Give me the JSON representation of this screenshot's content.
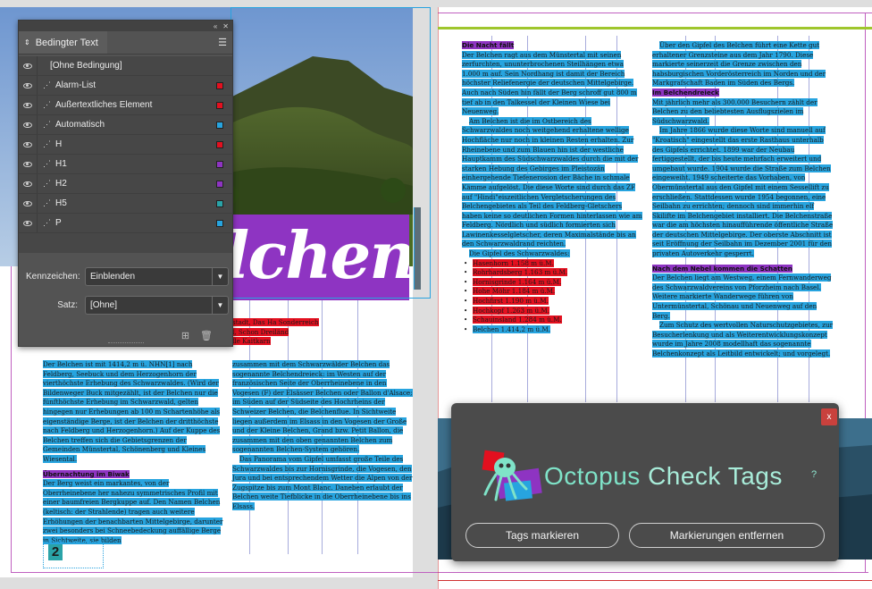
{
  "panel": {
    "title": "Bedingter Text",
    "conditions": [
      {
        "label": "[Ohne Bedingung]",
        "color": "",
        "visible": true,
        "icon": false
      },
      {
        "label": "Alarm-List",
        "color": "#e3101f",
        "visible": true,
        "icon": true
      },
      {
        "label": "Außertextliches Element",
        "color": "#e3101f",
        "visible": true,
        "icon": true
      },
      {
        "label": "Automatisch",
        "color": "#27a4df",
        "visible": true,
        "icon": true
      },
      {
        "label": "H",
        "color": "#e3101f",
        "visible": true,
        "icon": true
      },
      {
        "label": "H1",
        "color": "#8e34c2",
        "visible": true,
        "icon": true
      },
      {
        "label": "H2",
        "color": "#8e34c2",
        "visible": true,
        "icon": true
      },
      {
        "label": "H5",
        "color": "#2aa3a8",
        "visible": true,
        "icon": true
      },
      {
        "label": "P",
        "color": "#27a4df",
        "visible": true,
        "icon": true
      }
    ],
    "indicator_label": "Kennzeichen:",
    "indicator_value": "Einblenden",
    "set_label": "Satz:",
    "set_value": "[Ohne]"
  },
  "dialog": {
    "title_part1": "Octopus",
    "title_part2": "Check Tags",
    "help": "?",
    "close": "x",
    "button_mark": "Tags markieren",
    "button_remove": "Markierungen entfernen"
  },
  "document": {
    "page_number": "2",
    "big_word": "lchen",
    "col1": {
      "p1": "Der Belchen ist mit 1414,2 m ü. NHN[1] nach Feldberg, Seebuck und dem Herzogenhorn der vierthöchste Erhebung des Schwarzwaldes. (Wird der Bildenweger Buck mitgezählt, ist der Belchen nur die fünfthöchste Erhebung im Schwarzwald, gelten hingegen nur Erhebungen ab 100 m Schartenhöhe als eigenständige Berge, ist der Belchen der dritthöchste nach Feldberg und Herzogenhorn.) Auf der Kuppe des Belchen treffen sich die Gebietsgrenzen der Gemeinden Münstertal, Schönenberg und Kleines Wiesental.",
      "h": "Übernachtung im Biwak",
      "p2": "Der Berg weist ein markantes, von der Oberrheinebene her nahezu symmetrisches Profil mit einer baumfreien Bergkuppe auf. Den Namen Belchen (keltisch: der Strahlende) tragen auch weitere Erhöhungen der benachbarten Mittelgebirge, darunter zwei besonders bei Schneebedeckung auffällige Berge in Sichtweite, sie bilden"
    },
    "col2": {
      "red_lines": [
        "stadt, Das Ha Sonderreich",
        "l, Schon Dreiländ",
        "lle Kaitkarn"
      ],
      "p1": "zusammen mit dem Schwarzwälder Belchen das sogenannte Belchendreieck: im Westen auf der französischen Seite der Oberrheinebene in den Vogesen (F) der Elsässer Belchen oder Ballon d'Alsace; im Süden auf der Südseite des Hochrheins der Schweizer Belchen, die Belchenflue. In Sichtweite liegen außerdem im Elsass in den Vogesen der Große und der Kleine Belchen, Grand bzw. Petit Ballon, die zusammen mit den oben genannten Belchen zum sogenannten Belchen-System gehören.",
      "p2": "Das Panorama vom Gipfel umfasst große Teile des Schwarzwaldes bis zur Hornisgrinde, die Vogesen, den Jura und bei entsprechendem Wetter die Alpen von der Zugspitze bis zum Mont Blanc. Daneben erlaubt der Belchen weite Tiefblicke in die Oberrheinebene bis ins Elsass."
    },
    "col3": {
      "h": "Die Nacht fällt",
      "p1": "Der Belchen ragt aus dem Münstertal mit seinen zerfurchten, ununterbrochenen Steilhängen etwa 1.000 m auf. Sein Nordhang ist damit der Bereich höchster Reliefenergie der deutschen Mittelgebirge. Auch nach Süden hin fällt der Berg schroff gut 800 m tief ab in den Talkessel der Kleinen Wiese bei Neuenweg.",
      "p2": "Am Belchen ist die im Ostbereich des Schwarzwaldes noch weitgehend erhaltene wellige Hochfläche nur noch in kleinen Resten erhalten. Zur Rheinebene und zum Blauen hin ist der westliche Hauptkamm des Südschwarzwaldes durch die mit der starken Hebung des Gebirges im Pleistozän einhergehende Tiefenerosion der Bäche in schmale Kämme aufgelöst. Die diese Worte sind durch das ZF auf \"Hindi\"eiszeitlichen Vergletscherungen des Belchengebietes als Teil des Feldberg-Gletschers haben keine so deutlichen Formen hinterlassen wie am Feldberg. Nördlich und südlich formierten sich Lawinenkesselgletscher, deren Maximalstände bis an den Schwarzwaldrand reichten.",
      "list_intro": "Die Gipfel des Schwarzwaldes:",
      "list": [
        "Hasenhorn 1.158 m ü.M.",
        "Rohrhardsberg 1.163 m ü.M.",
        "Hornisgrinde 1.164 m ü.M.",
        "Hohe Möhr 1.184 m ü.M.",
        "Hochfirst 1.190 m ü.M.",
        "Hochkopf 1.263 m ü.M.",
        "Schauinsland 1.284 m ü.M.",
        "Belchen 1.414,2 m ü.M."
      ]
    },
    "col4": {
      "p1": "Über den Gipfel des Belchen führt eine Kette gut erhaltener Grenzsteine aus dem Jahr 1790. Diese markierte seinerzeit die Grenze zwischen den habsburgischen Vorderösterreich im Norden und der Markgrafschaft Baden im Süden des Bergs.",
      "h1": "Im Belchendreieck",
      "p2": "Mit jährlich mehr als 300.000 Besuchern zählt der Belchen zu den beliebtesten Ausflugszielen im Südschwarzwald.",
      "p3": "Im Jahre 1866 wurde diese Worte sind manuell auf \"Kroatisch\" eingestellt das erste Rasthaus unterhalb des Gipfels errichtet. 1899 war der Neubau fertiggestellt, der bis heute mehrfach erweitert und umgebaut wurde. 1904 wurde die Straße zum Belchen eingeweiht. 1949 scheiterte das Vorhaben, von Obermünstertal aus den Gipfel mit einem Sessellift zu erschließen. Stattdessen wurde 1954 begonnen, eine Seilbahn zu errichten; dennoch sind immerhin elf Skilifte im Belchengebiet installiert. Die Belchenstraße war die am höchsten hinaufführende öffentliche Straße der deutschen Mittelgebirge. Der oberste Abschnitt ist seit Eröffnung der Seilbahn im Dezember 2001 für den privaten Autoverkehr gesperrt.",
      "h2": "Nach dem Nebel kommen die Schatten",
      "p4": "Der Belchen liegt am Westweg, einem Fernwanderweg des Schwarzwaldvereins von Pforzheim nach Basel. Weitere markierte Wanderwege führen von Untermünstertal, Schönau und Neuenweg auf den Berg.",
      "p5": "Zum Schutz des wertvollen Naturschutzgebietes, zur Besucherlenkung und als Weiterentwicklungskonzept wurde im Jahre 2008 modellhaft das sogenannte Belchenkonzept als Leitbild entwickelt; und vorgelegt."
    }
  }
}
